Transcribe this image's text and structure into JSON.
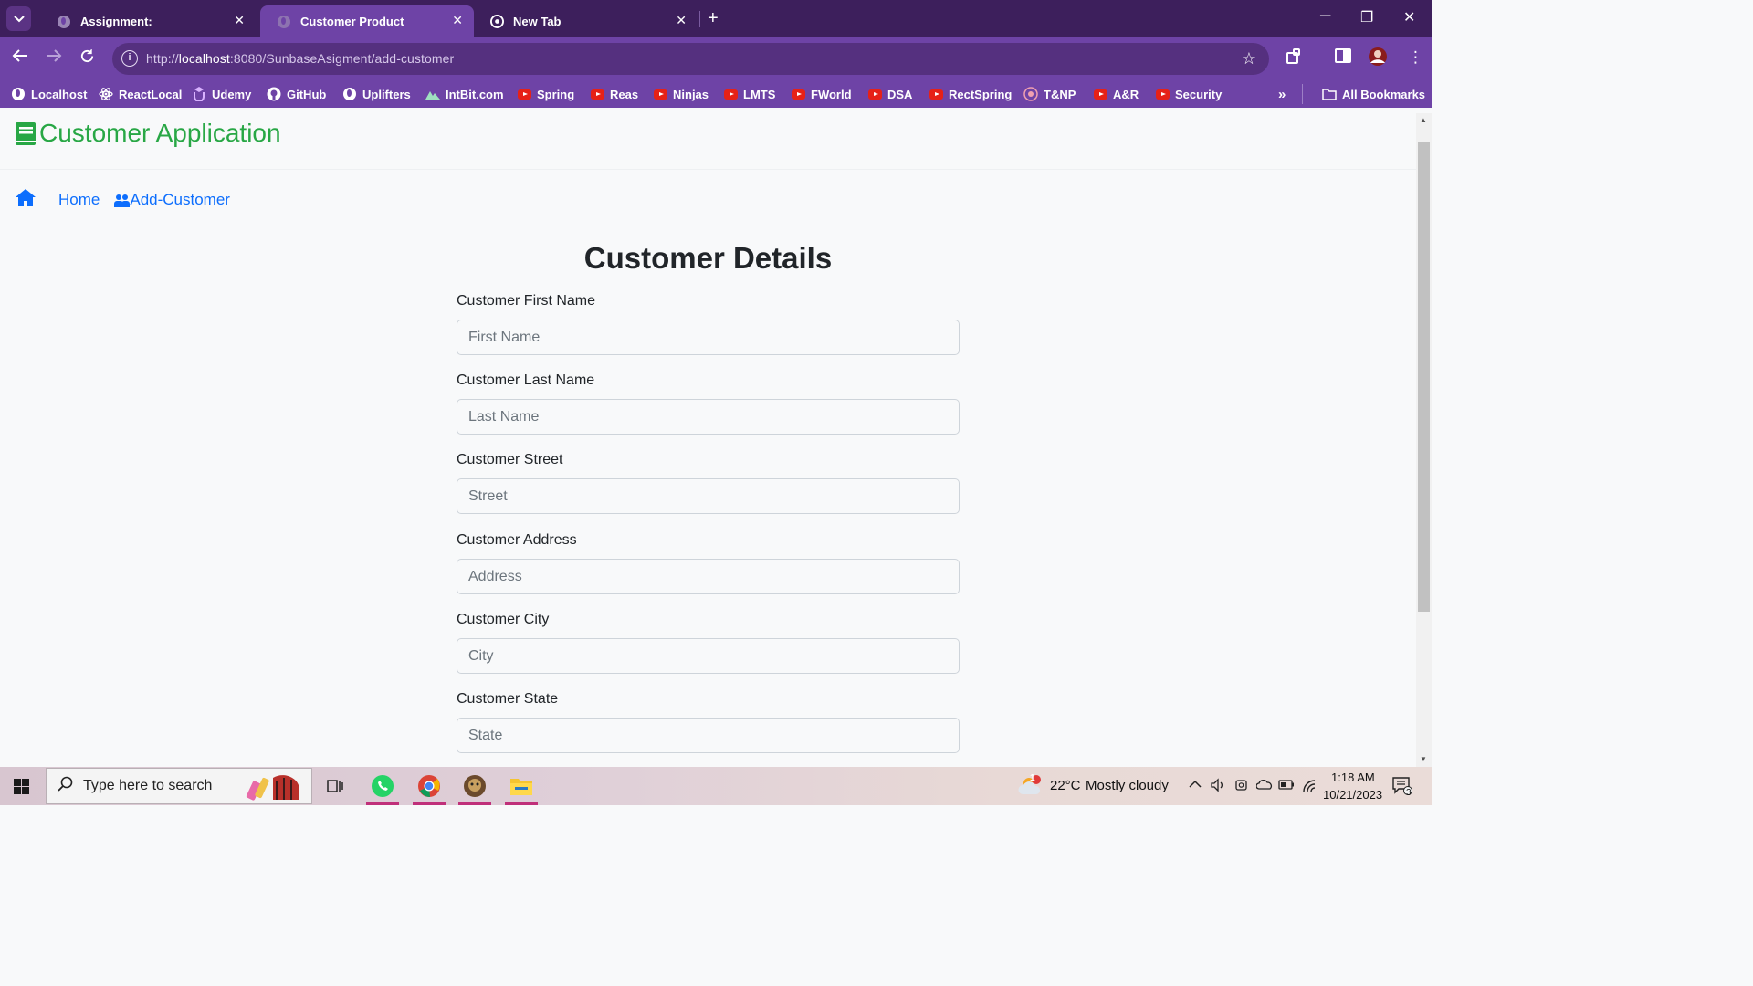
{
  "browser": {
    "tabs": [
      {
        "title": "Assignment:",
        "active": false
      },
      {
        "title": "Customer Product",
        "active": true
      },
      {
        "title": "New Tab",
        "active": false
      }
    ],
    "url_prefix": "http://",
    "url_host": "localhost",
    "url_rest": ":8080/SunbaseAsigment/add-customer",
    "bookmarks": [
      {
        "label": "Localhost",
        "icon": "globe-icon"
      },
      {
        "label": "ReactLocal",
        "icon": "react-icon"
      },
      {
        "label": "Udemy",
        "icon": "udemy-icon"
      },
      {
        "label": "GitHub",
        "icon": "github-icon"
      },
      {
        "label": "Uplifters",
        "icon": "globe-icon"
      },
      {
        "label": "IntBit.com",
        "icon": "mountain-icon"
      },
      {
        "label": "Spring",
        "icon": "youtube-icon"
      },
      {
        "label": "Reas",
        "icon": "youtube-icon"
      },
      {
        "label": "Ninjas",
        "icon": "youtube-icon"
      },
      {
        "label": "LMTS",
        "icon": "youtube-icon"
      },
      {
        "label": "FWorld",
        "icon": "youtube-icon"
      },
      {
        "label": "DSA",
        "icon": "youtube-icon"
      },
      {
        "label": "RectSpring",
        "icon": "youtube-icon"
      },
      {
        "label": "T&NP",
        "icon": "tnp-icon"
      },
      {
        "label": "A&R",
        "icon": "youtube-icon"
      },
      {
        "label": "Security",
        "icon": "youtube-icon"
      }
    ],
    "all_bookmarks": "All Bookmarks"
  },
  "app": {
    "brand": "Customer Application",
    "brand_color": "#28a745",
    "link_color": "#0d6efd",
    "breadcrumb_home": "Home",
    "breadcrumb_add": "Add-Customer"
  },
  "form": {
    "title": "Customer Details",
    "fields": [
      {
        "label": "Customer First Name",
        "placeholder": "First Name"
      },
      {
        "label": "Customer Last Name",
        "placeholder": "Last Name"
      },
      {
        "label": "Customer Street",
        "placeholder": "Street"
      },
      {
        "label": "Customer Address",
        "placeholder": "Address"
      },
      {
        "label": "Customer City",
        "placeholder": "City"
      },
      {
        "label": "Customer State",
        "placeholder": "State"
      }
    ]
  },
  "taskbar": {
    "search_placeholder": "Type here to search",
    "weather_temp": "22°C",
    "weather_desc": "Mostly cloudy",
    "time": "1:18 AM",
    "date": "10/21/2023",
    "notification_count": "3",
    "weather_badge": "1"
  }
}
